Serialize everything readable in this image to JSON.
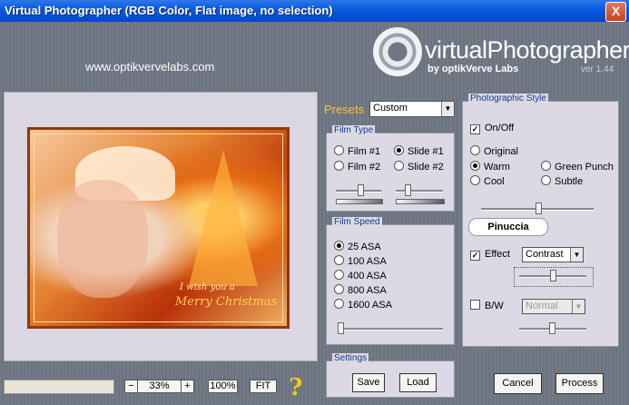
{
  "window": {
    "title": "Virtual Photographer (RGB Color, Flat image, no selection)",
    "close_label": "X"
  },
  "header": {
    "url": "www.optikvervelabs.com",
    "logo_text": "virtualPhotographer",
    "logo_by": "by optikVerve Labs",
    "version": "ver 1.44"
  },
  "preview": {
    "caption_line1": "I wish you a",
    "caption_line2": "Merry Christmas"
  },
  "zoom": {
    "minus": "−",
    "value": "33%",
    "plus": "+",
    "full": "100%",
    "fit": "FIT",
    "help": "?"
  },
  "presets": {
    "label": "Presets",
    "value": "Custom"
  },
  "film_type": {
    "title": "Film Type",
    "options": [
      "Film #1",
      "Slide #1",
      "Film #2",
      "Slide #2"
    ],
    "selected": "Slide #1"
  },
  "film_speed": {
    "title": "Film Speed",
    "options": [
      "25 ASA",
      "100 ASA",
      "400 ASA",
      "800 ASA",
      "1600 ASA"
    ],
    "selected": "25 ASA"
  },
  "settings": {
    "title": "Settings",
    "save": "Save",
    "load": "Load"
  },
  "style": {
    "title": "Photographic Style",
    "onoff": "On/Off",
    "onoff_checked": true,
    "options": [
      "Original",
      "Warm",
      "Green Punch",
      "Cool",
      "Subtle"
    ],
    "selected": "Warm",
    "preset_badge": "Pinuccia",
    "effect_label": "Effect",
    "effect_checked": true,
    "effect_value": "Contrast",
    "bw_label": "B/W",
    "bw_checked": false,
    "bw_value": "Normal"
  },
  "actions": {
    "cancel": "Cancel",
    "process": "Process"
  }
}
